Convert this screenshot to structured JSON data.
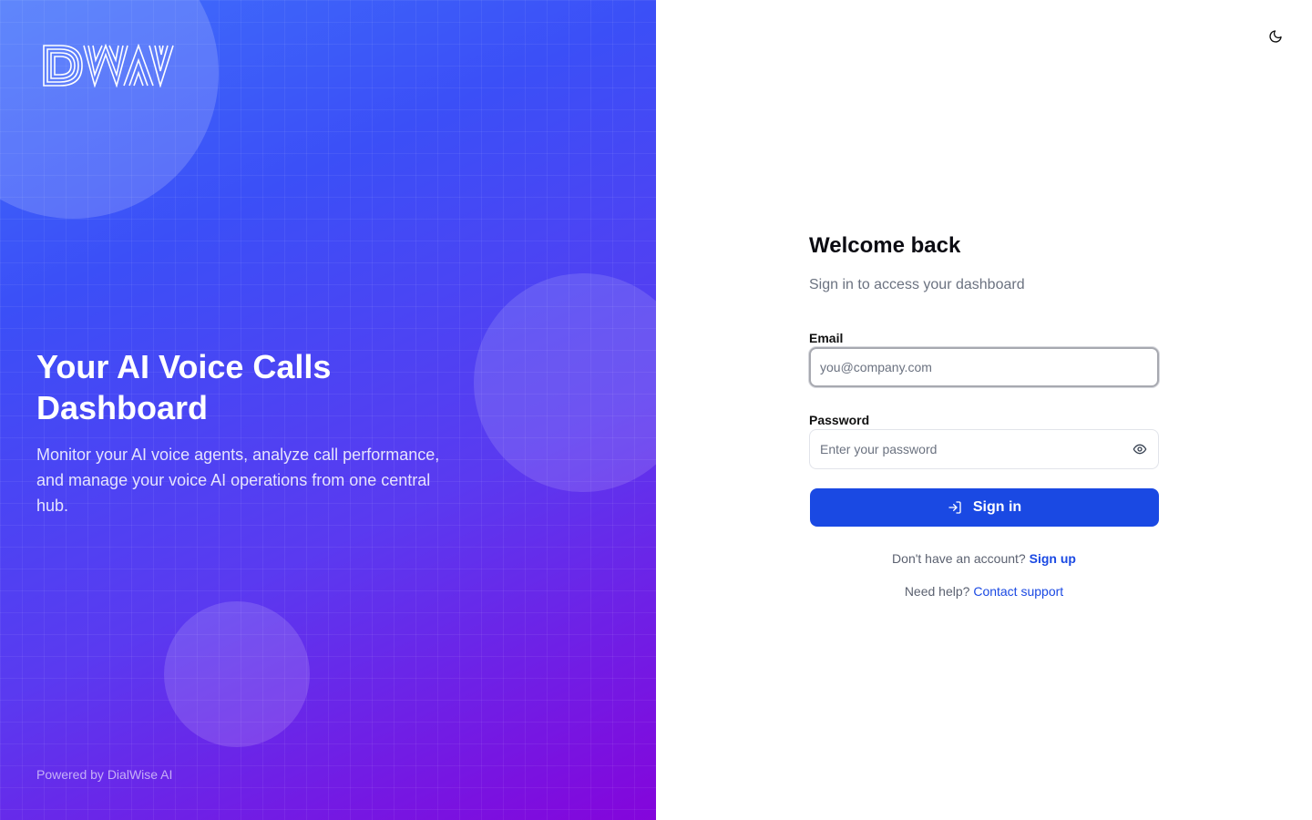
{
  "branding": {
    "logo_text": "DWAV",
    "hero_title": "Your AI Voice Calls Dashboard",
    "hero_subtitle": "Monitor your AI voice agents, analyze call performance, and manage your voice AI operations from one central hub.",
    "powered_by": "Powered by DialWise AI"
  },
  "header": {
    "theme_toggle_icon": "moon-icon"
  },
  "form": {
    "title": "Welcome back",
    "subtitle": "Sign in to access your dashboard",
    "email_label": "Email",
    "email_placeholder": "you@company.com",
    "email_value": "",
    "password_label": "Password",
    "password_placeholder": "Enter your password",
    "password_value": "",
    "password_toggle_icon": "eye-icon",
    "submit_icon": "log-in-icon",
    "submit_label": "Sign in",
    "signup_prompt": "Don't have an account?",
    "signup_link": "Sign up",
    "help_prompt": "Need help?",
    "help_link": "Contact support"
  },
  "colors": {
    "accent": "#1a49e3",
    "gradient_start": "#3f6ffb",
    "gradient_end": "#8405db"
  }
}
